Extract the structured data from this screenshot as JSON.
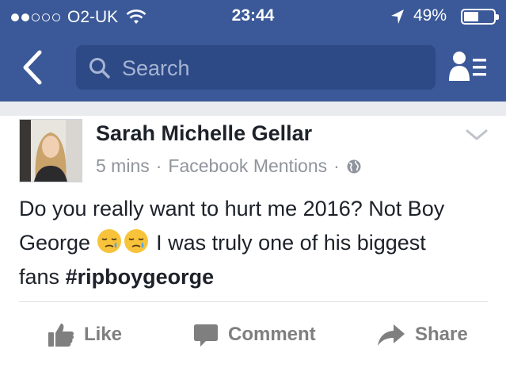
{
  "status_bar": {
    "carrier": "O2-UK",
    "time": "23:44",
    "battery_percent": "49%",
    "battery_level": 0.49,
    "signal_bars_filled": 2,
    "signal_bars_total": 5
  },
  "nav": {
    "search_placeholder": "Search",
    "icons": [
      "back-chevron-icon",
      "search-icon",
      "friend-requests-icon"
    ]
  },
  "post": {
    "author": "Sarah Michelle Gellar",
    "time": "5 mins",
    "source": "Facebook Mentions",
    "dot_separator": "·",
    "audience_icon": "globe-icon",
    "text_line1": "Do you really want to hurt me 2016? Not Boy",
    "text_line2_start": "George",
    "text_line2_end": "I was truly one of his biggest",
    "text_line3_start": "fans",
    "hashtag": "#ripboygeorge",
    "emojis": [
      "sleepy-face",
      "sleepy-face"
    ]
  },
  "actions": {
    "like": "Like",
    "comment": "Comment",
    "share": "Share"
  },
  "colors": {
    "brand": "#3b5998",
    "search_bg": "#2d4a86",
    "text": "#1d2129",
    "meta": "#90949c",
    "action": "#7f7f7f"
  }
}
